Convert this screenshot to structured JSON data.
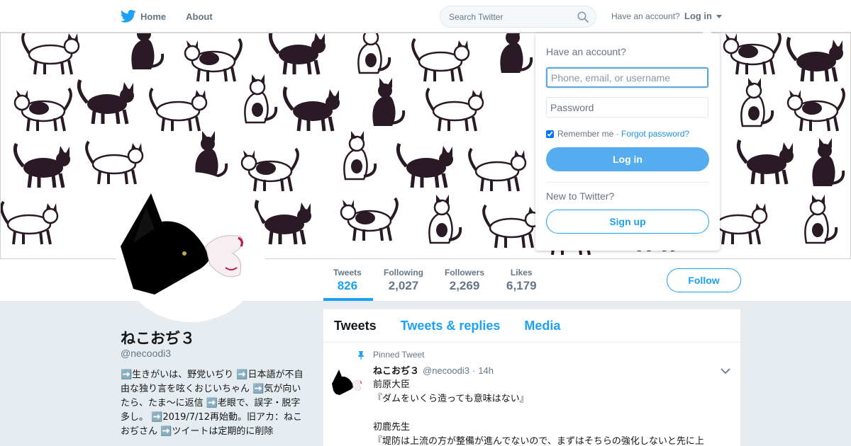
{
  "colors": {
    "accent": "#1da1f2",
    "page_bg": "#e6ecf0",
    "login_button": "#55acee"
  },
  "nav": {
    "home_label": "Home",
    "about_label": "About",
    "search_placeholder": "Search Twitter",
    "have_account": "Have an account?",
    "login_label": "Log in"
  },
  "profile": {
    "name": "ねこおぢ３",
    "handle": "@necoodi3",
    "bio": "➡️生きがいは、野党いぢり ➡️日本語が不自由な独り言を呟くおじいちゃん ➡️気が向いたら、たま～に返信 ➡️老眼で、誤字・脱字多し。 ➡️2019/7/12再始動。旧アカ：ねこおぢさん ➡️ツイートは定期的に削除"
  },
  "stats": [
    {
      "label": "Tweets",
      "value": "826"
    },
    {
      "label": "Following",
      "value": "2,027"
    },
    {
      "label": "Followers",
      "value": "2,269"
    },
    {
      "label": "Likes",
      "value": "6,179"
    }
  ],
  "follow_label": "Follow",
  "timeline": {
    "tabs": [
      "Tweets",
      "Tweets & replies",
      "Media"
    ],
    "pinned_tweet": {
      "pinned_label": "Pinned Tweet",
      "name": "ねこおぢ３",
      "handle": "@necoodi3",
      "dot": "·",
      "time": "14h",
      "text": "前原大臣\n『ダムをいくら造っても意味はない』\n\n初鹿先生\n『堤防は上流の方が整備が進んでないので、まずはそちらの強化しないと先に上"
    }
  },
  "login_dropdown": {
    "title": "Have an account?",
    "username_placeholder": "Phone, email, or username",
    "password_placeholder": "Password",
    "remember_label": "Remember me",
    "separator": "·",
    "forgot_label": "Forgot password?",
    "login_button": "Log in",
    "new_to": "New to Twitter?",
    "signup_button": "Sign up"
  }
}
